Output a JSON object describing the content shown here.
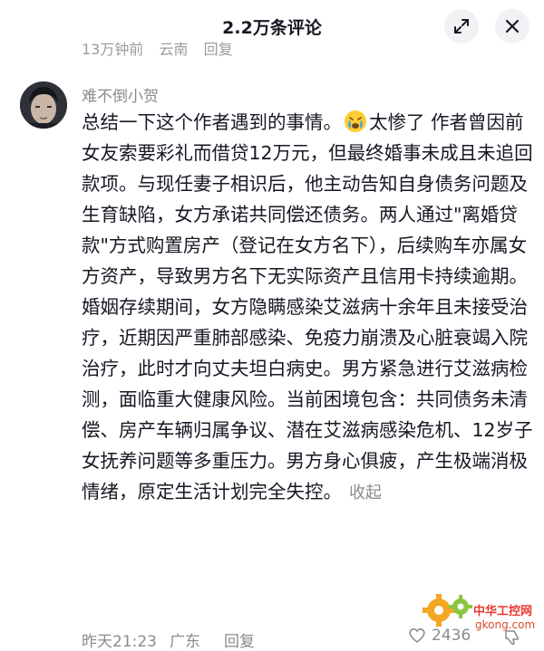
{
  "header": {
    "title": "2.2万条评论"
  },
  "previous_comment": {
    "time": "13万钟前",
    "location": "云南",
    "reply_label": "回复"
  },
  "comment": {
    "username": "难不倒小贺",
    "paragraph1_before_emoji": "总结一下这个作者遇到的事情。",
    "paragraph1_after_emoji": "太惨了 作者曾因前女友索要彩礼而借贷12万元，但最终婚事未成且未追回款项。与现任妻子相识后，他主动告知自身债务问题及生育缺陷，女方承诺共同偿还债务。两人通过\"离婚贷款\"方式购置房产（登记在女方名下），后续购车亦属女方资产，导致男方名下无实际资产且信用卡持续逾期。",
    "paragraph2": "婚姻存续期间，女方隐瞒感染艾滋病十余年且未接受治疗，近期因严重肺部感染、免疫力崩溃及心脏衰竭入院治疗，此时才向丈夫坦白病史。男方紧急进行艾滋病检测，面临重大健康风险。当前困境包含：共同债务未清偿、房产车辆归属争议、潜在艾滋病感染危机、12岁子女抚养问题等多重压力。男方身心俱疲，产生极端消极情绪，原定生活计划完全失控。",
    "collapse_label": "收起",
    "time": "昨天21:23",
    "location": "广东",
    "reply_label": "回复",
    "like_count": "2436"
  },
  "watermark": {
    "line1": "中华工控网",
    "line2": "gkong.com"
  },
  "colors": {
    "text": "#161823",
    "muted": "#8a8b91",
    "watermark_red": "#e83a2e",
    "watermark_gear": "#f5a623"
  }
}
